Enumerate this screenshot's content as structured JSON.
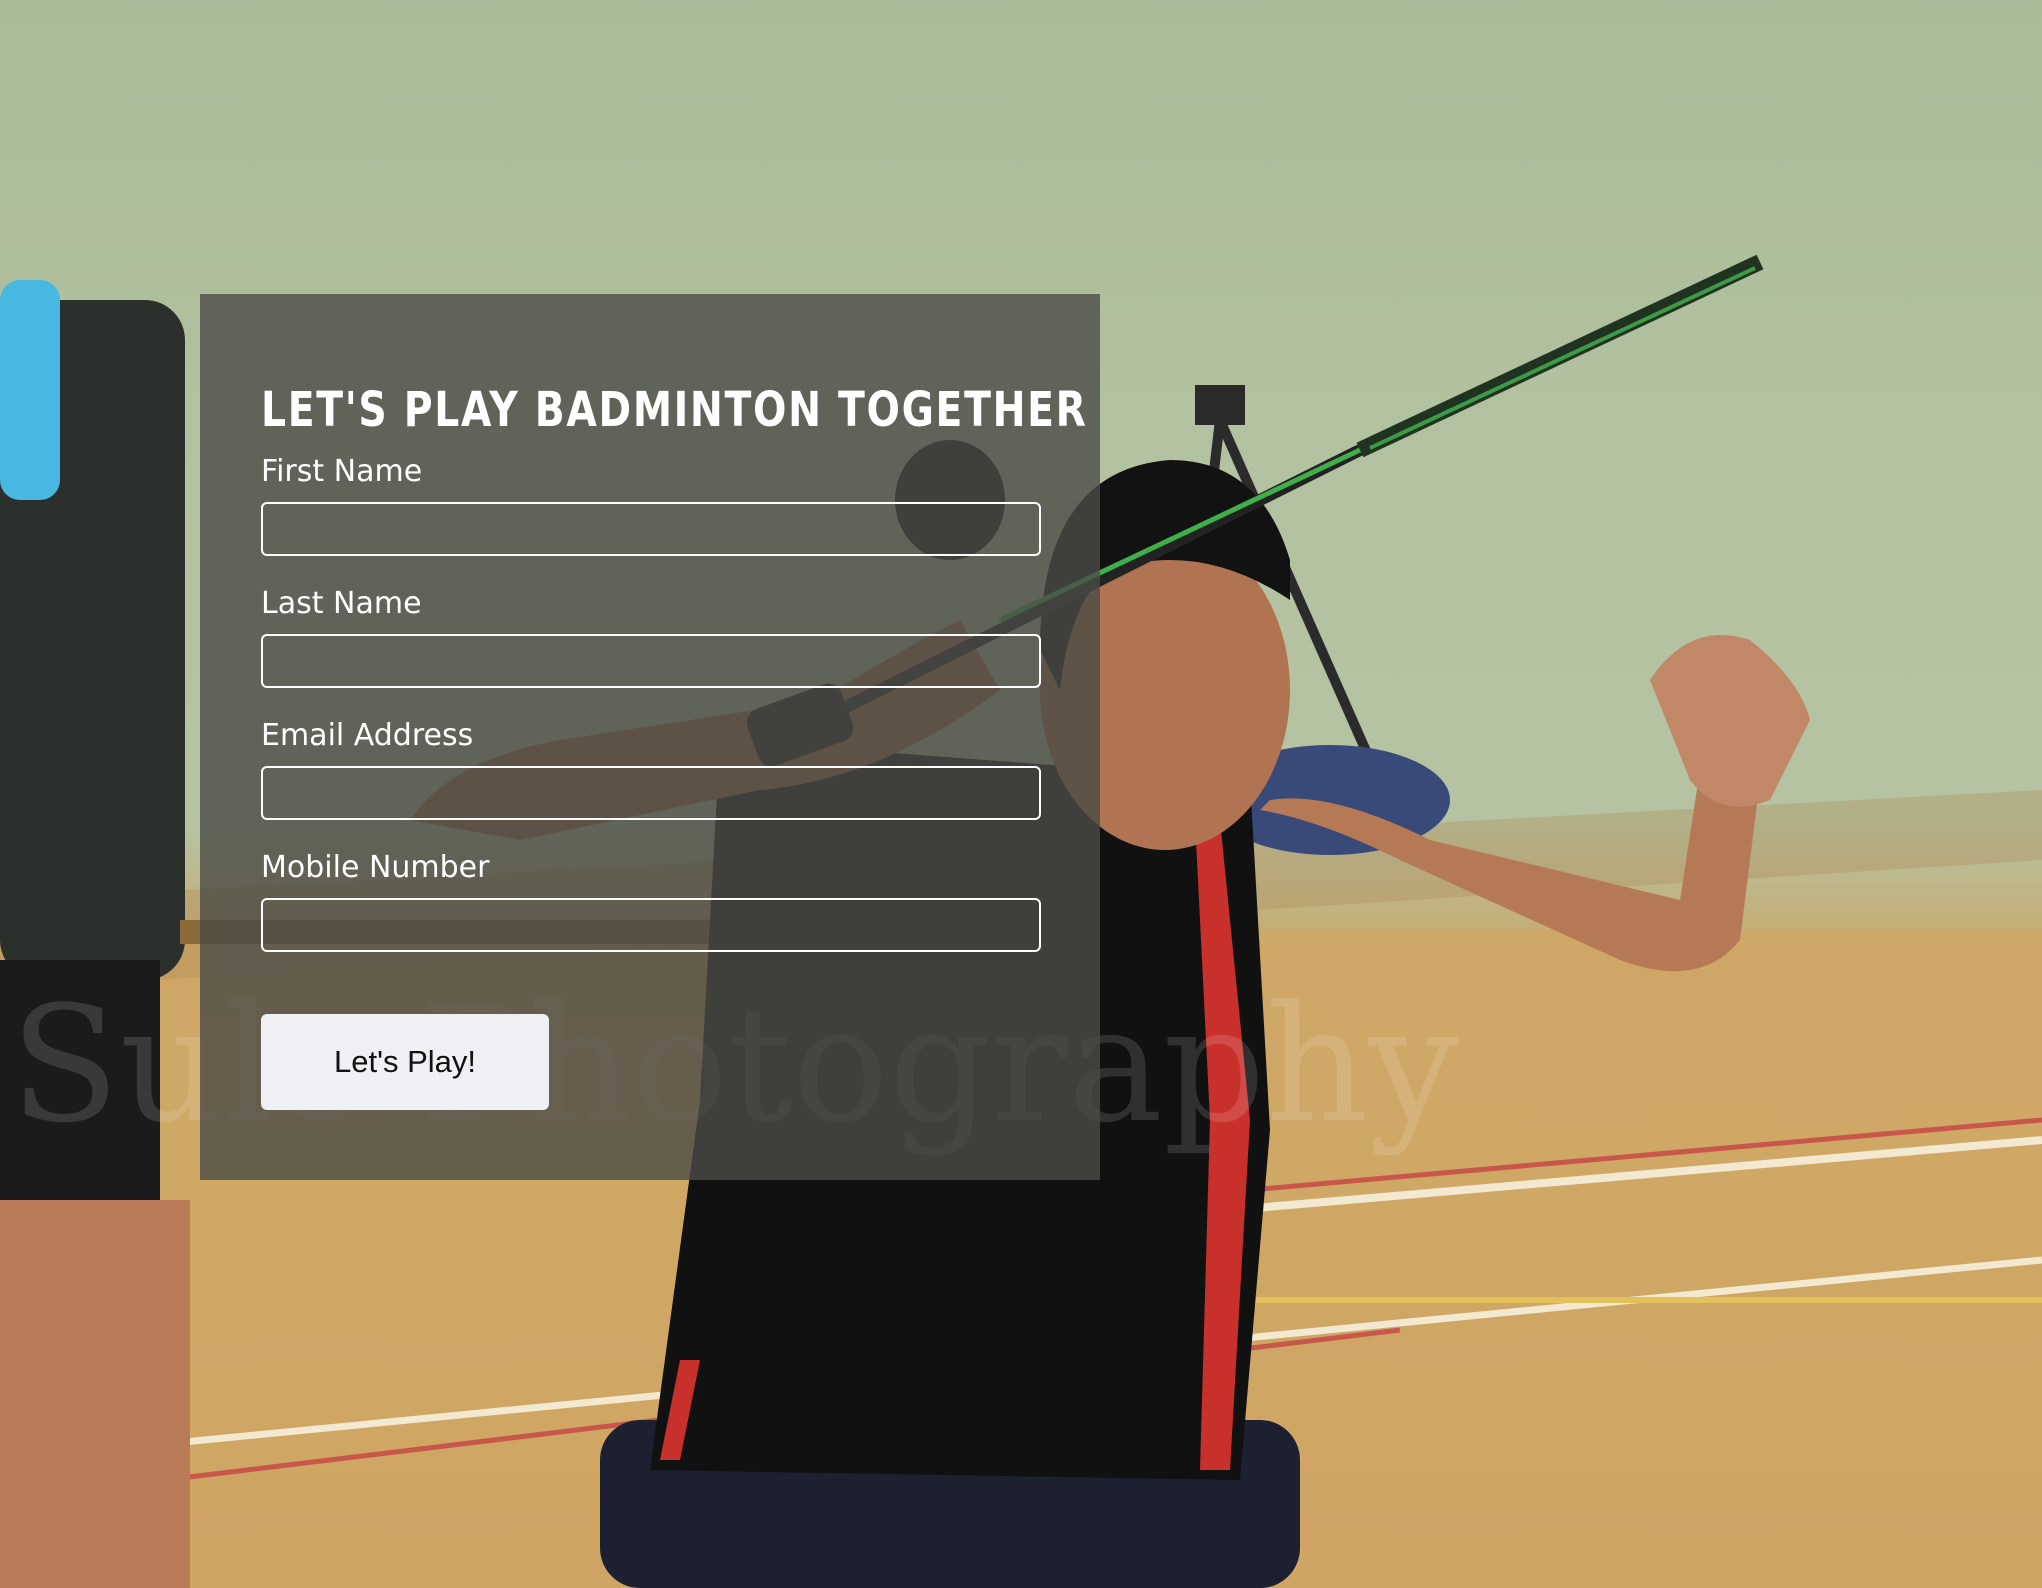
{
  "form": {
    "title": "LET'S PLAY BADMINTON TOGETHER",
    "fields": [
      {
        "label": "First Name",
        "value": ""
      },
      {
        "label": "Last Name",
        "value": ""
      },
      {
        "label": "Email Address",
        "value": ""
      },
      {
        "label": "Mobile Number",
        "value": ""
      }
    ],
    "submit_label": "Let's Play!"
  },
  "background": {
    "watermark_text": "Sulo Photography"
  },
  "colors": {
    "panel_overlay": "#4b4b46",
    "text": "#ffffff",
    "button_background": "#eef0f4",
    "button_text": "#111111",
    "wall": "#b5c3a2",
    "floor": "#d2ab6a"
  }
}
